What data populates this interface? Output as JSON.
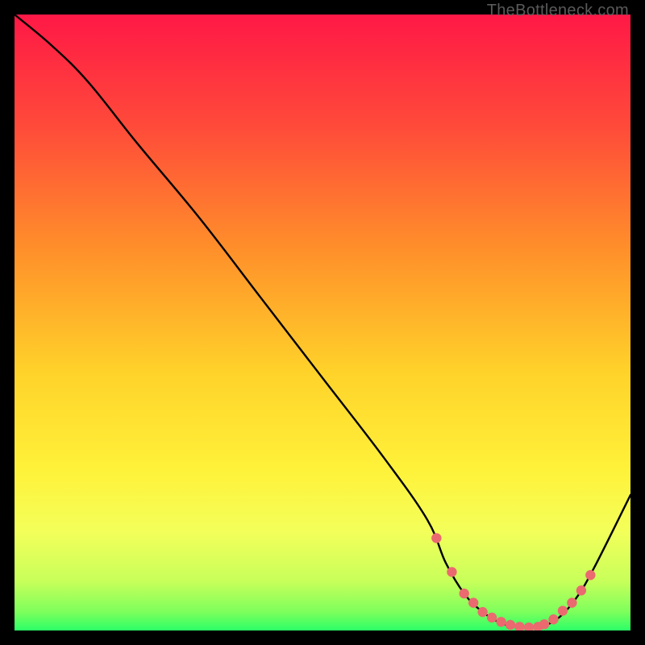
{
  "attribution": "TheBottleneck.com",
  "colors": {
    "gradient_top": "#ff1846",
    "gradient_mid1": "#ff7f2a",
    "gradient_mid2": "#ffe02a",
    "gradient_mid3": "#f5ff5a",
    "gradient_bottom": "#2bff67",
    "curve": "#000000",
    "marker": "#ea6a6f",
    "frame": "#000000"
  },
  "chart_data": {
    "type": "line",
    "title": "",
    "xlabel": "",
    "ylabel": "",
    "xlim": [
      0,
      100
    ],
    "ylim": [
      0,
      100
    ],
    "grid": false,
    "legend": false,
    "series": [
      {
        "name": "bottleneck-curve",
        "x": [
          0,
          6,
          12,
          20,
          30,
          40,
          50,
          60,
          67,
          70,
          73,
          76,
          79,
          82,
          85,
          88,
          91,
          94,
          100
        ],
        "y": [
          100,
          95,
          89,
          79,
          67,
          54,
          41,
          28,
          18,
          11,
          6,
          3,
          1.2,
          0.6,
          0.6,
          1.8,
          5,
          10,
          22
        ]
      }
    ],
    "markers": {
      "name": "highlight-points",
      "x": [
        68.5,
        71,
        73,
        74.5,
        76,
        77.5,
        79,
        80.5,
        82,
        83.5,
        85,
        86,
        87.5,
        89,
        90.5,
        92,
        93.5
      ],
      "y": [
        15,
        9.5,
        6,
        4.5,
        3,
        2.1,
        1.4,
        0.9,
        0.6,
        0.5,
        0.6,
        1.0,
        1.8,
        3.2,
        4.5,
        6.5,
        9
      ]
    }
  }
}
